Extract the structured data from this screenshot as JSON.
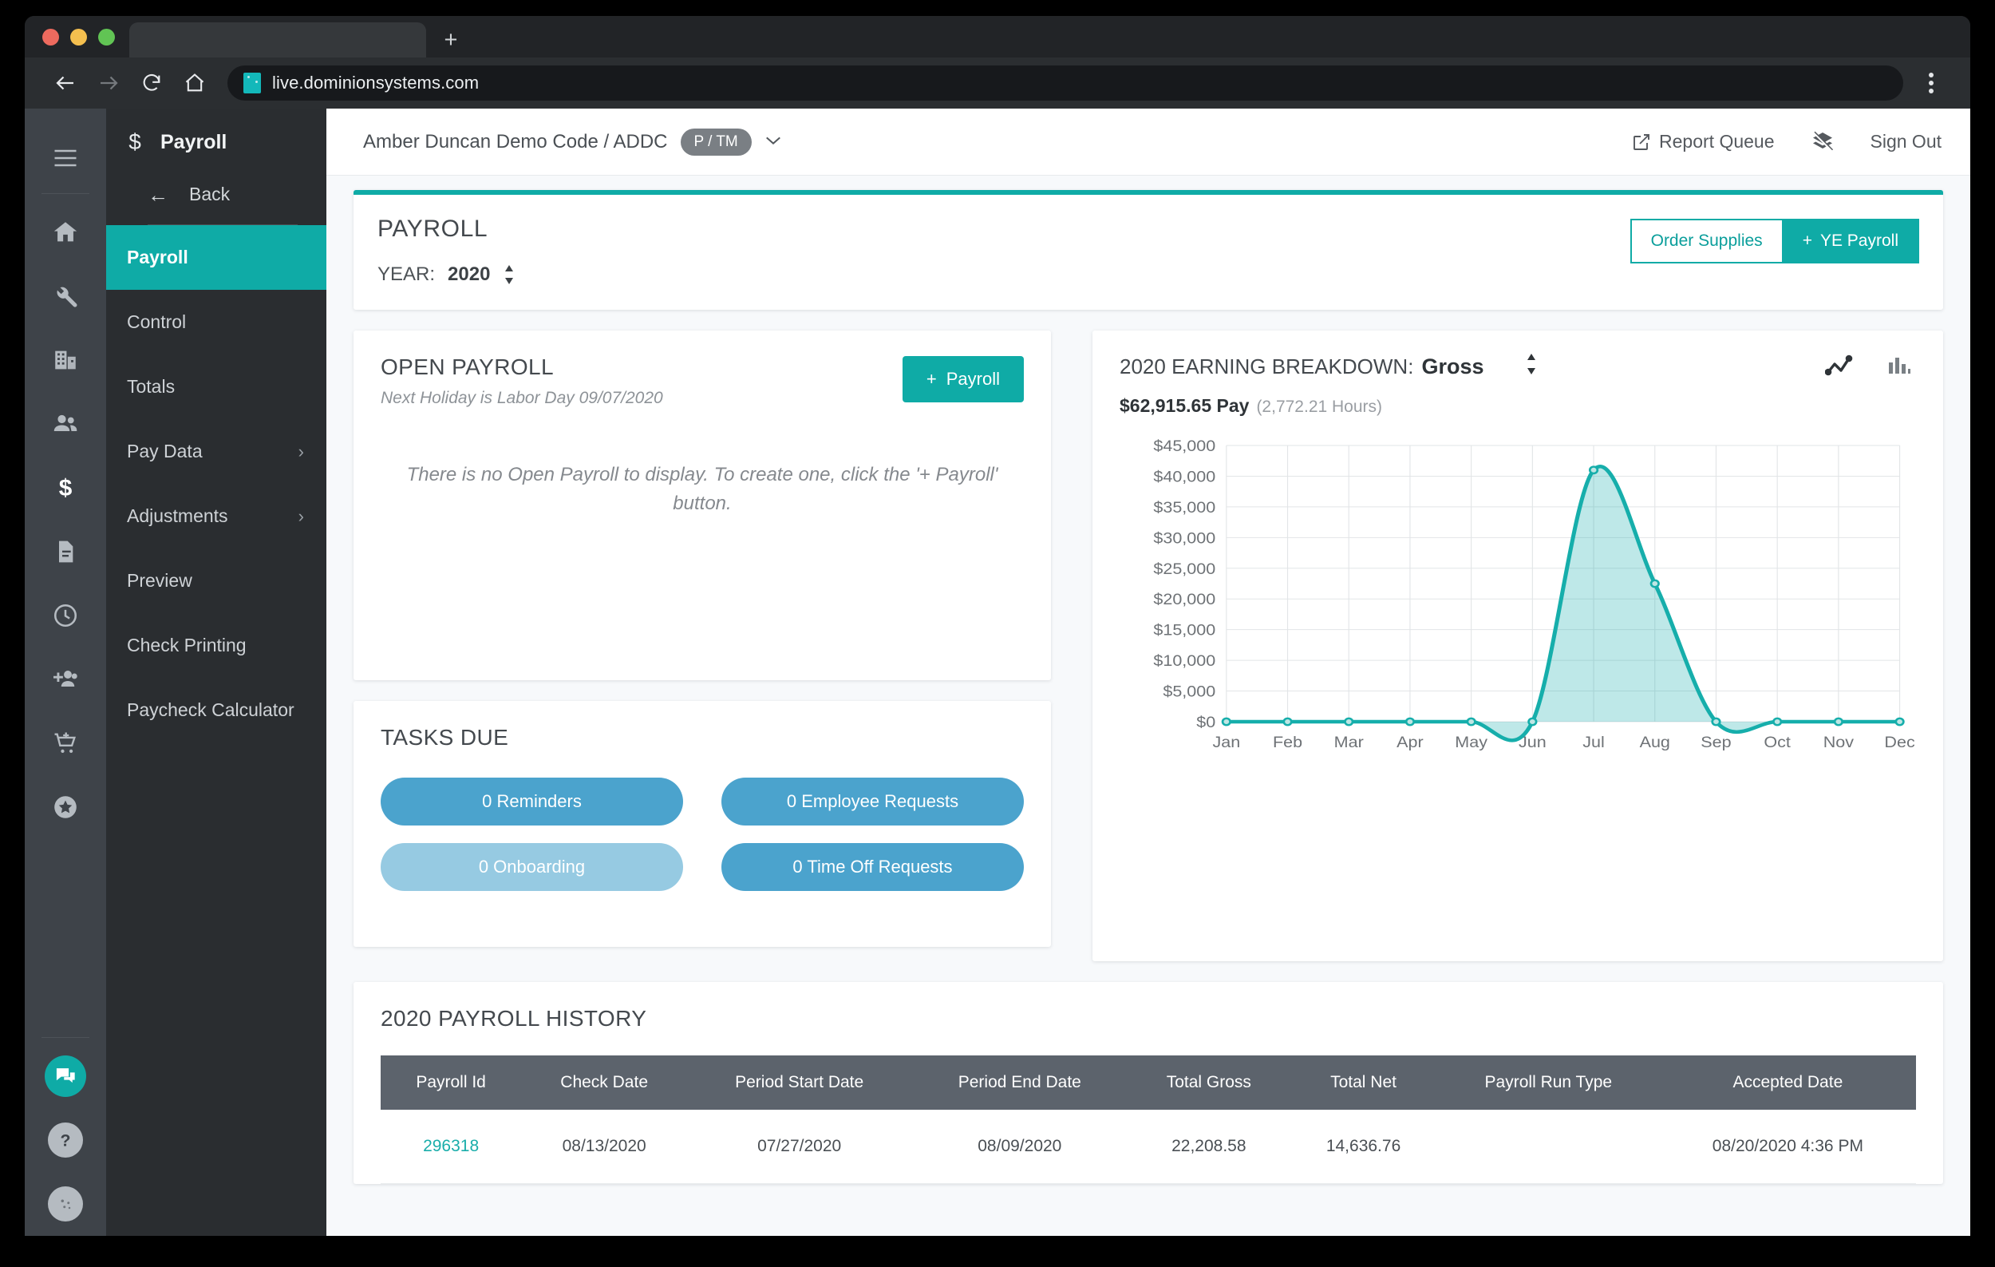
{
  "browser": {
    "url": "live.dominionsystems.com",
    "new_tab_label": "+",
    "back_icon": "back-arrow-icon",
    "forward_icon": "forward-arrow-icon",
    "reload_icon": "reload-icon",
    "home_icon": "home-icon",
    "menu_icon": "kebab-menu-icon"
  },
  "rail": {
    "items": [
      {
        "name": "hamburger-menu",
        "glyph": "menu"
      },
      {
        "name": "home",
        "glyph": "home"
      },
      {
        "name": "tools",
        "glyph": "wrench"
      },
      {
        "name": "company",
        "glyph": "building"
      },
      {
        "name": "employees",
        "glyph": "people"
      },
      {
        "name": "payroll",
        "glyph": "dollar"
      },
      {
        "name": "reports",
        "glyph": "document"
      },
      {
        "name": "time",
        "glyph": "clock"
      },
      {
        "name": "recruiting",
        "glyph": "person-add"
      },
      {
        "name": "marketplace",
        "glyph": "cart-add"
      },
      {
        "name": "benefits",
        "glyph": "star"
      }
    ],
    "bottom": [
      {
        "name": "chat",
        "glyph": "chat"
      },
      {
        "name": "help",
        "glyph": "question"
      },
      {
        "name": "profile",
        "glyph": "avatar"
      }
    ]
  },
  "subnav": {
    "title": "Payroll",
    "title_icon": "dollar-icon",
    "back_label": "Back",
    "items": [
      {
        "label": "Payroll",
        "active": true,
        "chevron": false
      },
      {
        "label": "Control",
        "active": false,
        "chevron": false
      },
      {
        "label": "Totals",
        "active": false,
        "chevron": false
      },
      {
        "label": "Pay Data",
        "active": false,
        "chevron": true
      },
      {
        "label": "Adjustments",
        "active": false,
        "chevron": true
      },
      {
        "label": "Preview",
        "active": false,
        "chevron": false
      },
      {
        "label": "Check Printing",
        "active": false,
        "chevron": false
      },
      {
        "label": "Paycheck Calculator",
        "active": false,
        "chevron": false
      }
    ],
    "chevron_glyph": "›"
  },
  "topbar": {
    "company": "Amber Duncan Demo Code / ADDC",
    "badge": "P / TM",
    "caret": "⌄",
    "report_queue": "Report Queue",
    "sign_out": "Sign Out",
    "layers_icon": "layers-off-icon",
    "external_icon": "external-link-icon"
  },
  "payroll_panel": {
    "title": "PAYROLL",
    "year_label": "YEAR:",
    "year_value": "2020",
    "order_supplies": "Order Supplies",
    "ye_payroll": "YE Payroll",
    "plus": "+"
  },
  "open_payroll": {
    "title": "OPEN PAYROLL",
    "subtitle": "Next Holiday is Labor Day 09/07/2020",
    "button": "Payroll",
    "plus": "+",
    "empty_message": "There is no Open Payroll to display. To create one, click the '+ Payroll' button."
  },
  "tasks": {
    "title": "TASKS DUE",
    "pills": [
      {
        "label": "0 Reminders",
        "light": false
      },
      {
        "label": "0 Employee Requests",
        "light": false
      },
      {
        "label": "0 Onboarding",
        "light": true
      },
      {
        "label": "0 Time Off Requests",
        "light": false
      }
    ]
  },
  "earnings": {
    "title": "2020 EARNING BREAKDOWN:",
    "selected": "Gross",
    "pay_amount": "$62,915.65 Pay",
    "hours": "(2,772.21 Hours)",
    "line_icon": "line-chart-icon",
    "bar_icon": "bar-chart-icon"
  },
  "history": {
    "title": "2020 PAYROLL HISTORY",
    "columns": [
      "Payroll Id",
      "Check Date",
      "Period Start Date",
      "Period End Date",
      "Total Gross",
      "Total Net",
      "Payroll Run Type",
      "Accepted Date"
    ],
    "rows": [
      {
        "payroll_id": "296318",
        "check_date": "08/13/2020",
        "period_start": "07/27/2020",
        "period_end": "08/09/2020",
        "total_gross": "22,208.58",
        "total_net": "14,636.76",
        "run_type": "",
        "accepted_date": "08/20/2020 4:36 PM"
      }
    ]
  },
  "colors": {
    "teal": "#0faba6",
    "rail_bg": "#3e4349",
    "subnav_bg": "#2a2d30",
    "pill_blue": "#4ba3cd",
    "pill_blue_light": "#96cae2",
    "table_header": "#5c636c"
  },
  "chart_data": {
    "type": "area",
    "title": "2020 EARNING BREAKDOWN: Gross",
    "categories": [
      "Jan",
      "Feb",
      "Mar",
      "Apr",
      "May",
      "Jun",
      "Jul",
      "Aug",
      "Sep",
      "Oct",
      "Nov",
      "Dec"
    ],
    "values": [
      0,
      0,
      0,
      0,
      0,
      0,
      41000,
      22500,
      0,
      0,
      0,
      0
    ],
    "ytick_labels": [
      "$0",
      "$5,000",
      "$10,000",
      "$15,000",
      "$20,000",
      "$25,000",
      "$30,000",
      "$35,000",
      "$40,000",
      "$45,000"
    ],
    "ylim": [
      0,
      45000
    ],
    "xlabel": "",
    "ylabel": "",
    "grid": true,
    "legend": "none",
    "line_color": "#16aeab",
    "fill_color": "rgba(22,174,171,0.28)"
  }
}
